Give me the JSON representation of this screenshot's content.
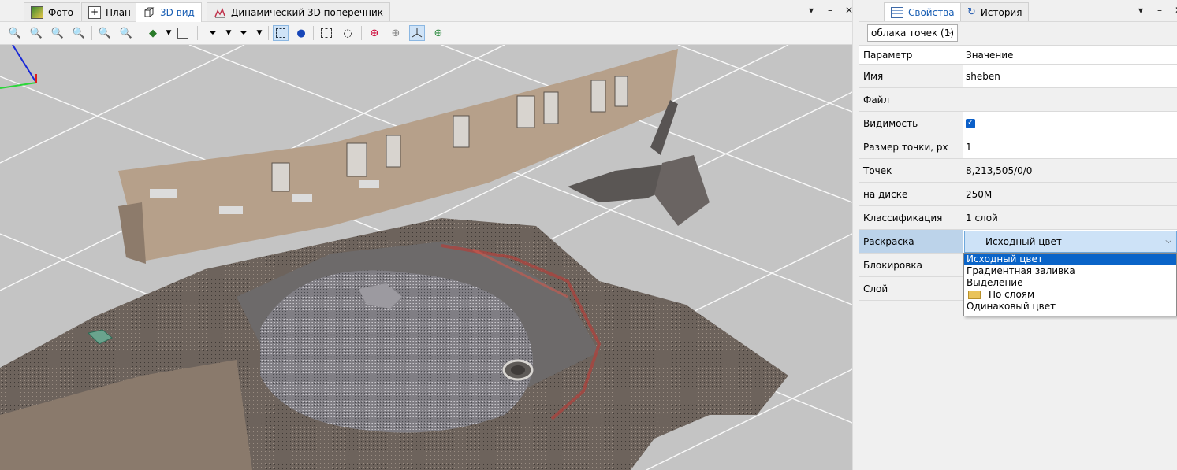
{
  "left_panel": {
    "tabs": [
      {
        "label": "Фото",
        "icon": "photo-icon"
      },
      {
        "label": "План",
        "icon": "plan-icon"
      },
      {
        "label": "3D вид",
        "icon": "cube-icon",
        "active": true
      },
      {
        "label": "Динамический 3D поперечник",
        "icon": "cross-section-icon"
      }
    ],
    "window_buttons": [
      "▾",
      "–",
      "✕"
    ],
    "toolbar_icons": [
      "zoom-extents-icon",
      "zoom-in-icon",
      "zoom-out-icon",
      "zoom-window-icon",
      "zoom-selected-icon",
      "zoom-previous-icon",
      "view-orient-icon",
      "dropdown-arrow-icon",
      "frame-icon",
      "filter-icon",
      "dropdown-arrow-icon",
      "filter-add-icon",
      "dropdown-arrow-icon",
      "select-rect-icon",
      "point-pick-icon",
      "rect-select-icon",
      "lasso-select-icon",
      "globe-icon",
      "globe-grid-icon",
      "axis-icon",
      "globe-color-icon"
    ],
    "viewport": {
      "description_name": "point-cloud-3d-view"
    }
  },
  "right_panel": {
    "tabs": [
      {
        "label": "Свойства",
        "icon": "properties-icon",
        "active": true
      },
      {
        "label": "История",
        "icon": "history-icon"
      }
    ],
    "window_buttons": [
      "▾",
      "–",
      "✕"
    ],
    "object_select": {
      "value": "облака точек (1)"
    },
    "grid": {
      "header_key": "Параметр",
      "header_value": "Значение",
      "rows": [
        {
          "key": "Имя",
          "value": "sheben"
        },
        {
          "key": "Файл",
          "value": ""
        },
        {
          "key": "Видимость",
          "value": "checked"
        },
        {
          "key": "Размер точки, px",
          "value": "1"
        },
        {
          "key": "Точек",
          "value": "8,213,505/0/0"
        },
        {
          "key": "на диске",
          "value": "250M"
        },
        {
          "key": "Классификация",
          "value": "1 слой"
        },
        {
          "key": "Раскраска",
          "value": "Исходный цвет"
        },
        {
          "key": "Блокировка",
          "value": ""
        },
        {
          "key": "Слой",
          "value": ""
        }
      ]
    },
    "coloring_dropdown": {
      "options": [
        {
          "label": "Исходный цвет",
          "highlighted": true
        },
        {
          "label": "Градиентная заливка"
        },
        {
          "label": "Выделение"
        },
        {
          "label": "По слоям",
          "icon": "folder-icon"
        },
        {
          "label": "Одинаковый цвет"
        }
      ]
    }
  },
  "colors": {
    "selection": "#0a64c8",
    "viewport_bg": "#c4c4c4",
    "active_tab_text": "#1a5fb4"
  }
}
